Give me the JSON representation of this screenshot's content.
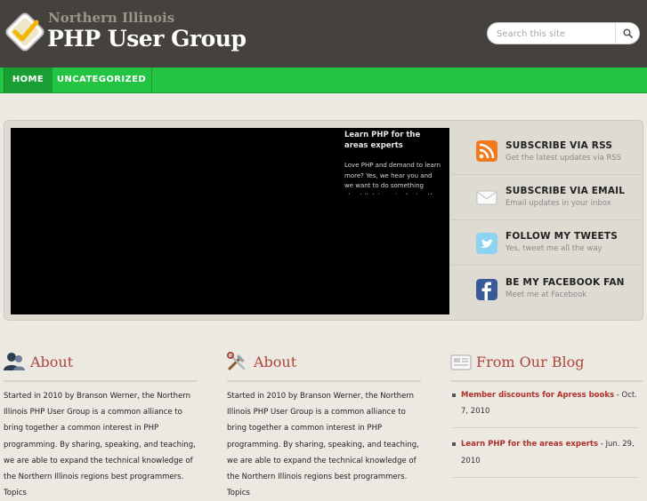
{
  "header": {
    "site_name_small": "Northern Illinois",
    "site_name_big": "PHP User Group",
    "search_placeholder": "Search this site"
  },
  "nav": {
    "items": [
      {
        "label": "HOME",
        "active": true
      },
      {
        "label": "UNCATEGORIZED",
        "active": false
      }
    ]
  },
  "slider": {
    "title": "Learn PHP for the areas experts",
    "text": "Love PHP and demand to learn more? Yes, we hear you and we want to do something about it. Join us in sharing the"
  },
  "subscribe": [
    {
      "title": "SUBSCRIBE VIA RSS",
      "desc": "Get the latest updates via RSS",
      "icon": "rss-icon",
      "color": "#f07a1c"
    },
    {
      "title": "SUBSCRIBE VIA EMAIL",
      "desc": "Email updates in your inbox",
      "icon": "envelope-icon",
      "color": "#ffffff"
    },
    {
      "title": "FOLLOW MY TWEETS",
      "desc": "Yes, tweet me all the way",
      "icon": "twitter-icon",
      "color": "#55b7e6"
    },
    {
      "title": "BE MY FACEBOOK FAN",
      "desc": "Meet me at Facebook",
      "icon": "facebook-icon",
      "color": "#3b5998"
    }
  ],
  "columns": {
    "about1": {
      "title": "About",
      "text": "Started in 2010 by Branson Werner, the Northern Illinois PHP User Group is a common alliance to bring together a common interest in PHP programming. By sharing, speaking, and teaching, we are able to expand the technical knowledge of the Northern Illinois regions best programmers. Topics"
    },
    "about2": {
      "title": "About",
      "text": "Started in 2010 by Branson Werner, the Northern Illinois PHP User Group is a common alliance to bring together a common interest in PHP programming. By sharing, speaking, and teaching, we are able to expand the technical knowledge of the Northern Illinois regions best programmers. Topics"
    },
    "blog": {
      "title": "From Our Blog",
      "posts": [
        {
          "title": "Member discounts for Apress books",
          "date": " - Oct. 7, 2010"
        },
        {
          "title": "Learn PHP for the areas experts",
          "date": " - Jun. 29, 2010"
        }
      ]
    }
  },
  "colors": {
    "header_bg": "#45413c",
    "nav_green": "#24c443",
    "accent_red": "#b0443a"
  }
}
